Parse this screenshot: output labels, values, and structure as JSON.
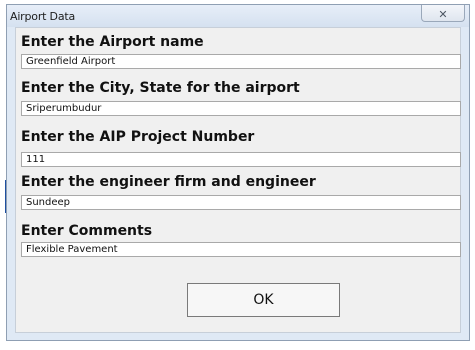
{
  "window": {
    "title": "Airport Data",
    "close_glyph": "✕"
  },
  "fields": [
    {
      "label": "Enter the Airport name",
      "value": "Greenfield Airport"
    },
    {
      "label": "Enter the City, State for the airport",
      "value": "Sriperumbudur"
    },
    {
      "label": "Enter the AIP Project Number",
      "value": "111"
    },
    {
      "label": "Enter the engineer firm and engineer",
      "value": "Sundeep"
    },
    {
      "label": "Enter Comments",
      "value": "Flexible Pavement"
    }
  ],
  "buttons": {
    "ok_label": "OK"
  }
}
